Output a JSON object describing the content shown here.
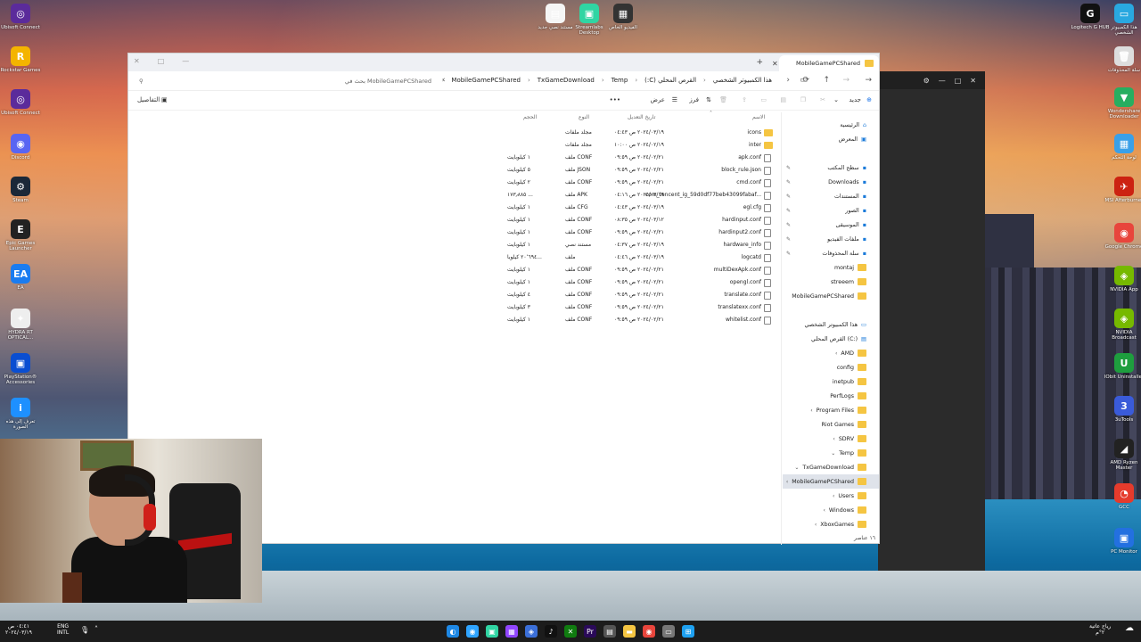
{
  "desktop_left": [
    {
      "label": "Ubisoft Connect",
      "color": "#5b2b9b",
      "glyph": "◎"
    },
    {
      "label": "Rockstar Games",
      "color": "#f4b400",
      "glyph": "R"
    },
    {
      "label": "Ubisoft Connect",
      "color": "#5b2b9b",
      "glyph": "◎"
    },
    {
      "label": "Discord",
      "color": "#5865f2",
      "glyph": "◉"
    },
    {
      "label": "Steam",
      "color": "#1b2838",
      "glyph": "⚙"
    },
    {
      "label": "Epic Games Launcher",
      "color": "#222",
      "glyph": "E"
    },
    {
      "label": "EA",
      "color": "#1a7cf0",
      "glyph": "EA"
    },
    {
      "label": "HYDRA RT OPTICAL...",
      "color": "#eee",
      "glyph": "✦"
    },
    {
      "label": "PlayStation® Accessories",
      "color": "#0a4ed1",
      "glyph": "▣"
    },
    {
      "label": "تعرف إلى هذه الصورة",
      "color": "#1e90ff",
      "glyph": "i"
    }
  ],
  "desktop_top": [
    {
      "label": "مستند نصي جديد",
      "color": "#f5f5f5",
      "glyph": "▤"
    },
    {
      "label": "Streamlabs Desktop",
      "color": "#30d5a3",
      "glyph": "▣"
    },
    {
      "label": "الفيديو الخاص",
      "color": "#333",
      "glyph": "▦"
    }
  ],
  "desktop_right": [
    {
      "label": "Logitech G HUB",
      "color": "#111",
      "glyph": "G"
    },
    {
      "label": "هذا الكمبيوتر الشخصي",
      "color": "#29a8e0",
      "glyph": "▭"
    },
    {
      "label": "سلة المحذوفات",
      "color": "#ddd",
      "glyph": "🗑"
    },
    {
      "label": "Wondershare Downloader",
      "color": "#27ae60",
      "glyph": "▼"
    },
    {
      "label": "لوحة التحكم",
      "color": "#3aa0e8",
      "glyph": "▦"
    },
    {
      "label": "MSI Afterburner",
      "color": "#c21",
      "glyph": "✈"
    },
    {
      "label": "Google Chrome",
      "color": "#e8453c",
      "glyph": "◉"
    },
    {
      "label": "NVIDIA App",
      "color": "#76b900",
      "glyph": "◈"
    },
    {
      "label": "NVIDIA Broadcast",
      "color": "#76b900",
      "glyph": "◈"
    },
    {
      "label": "IObit Uninstaller",
      "color": "#1e9e3e",
      "glyph": "U"
    },
    {
      "label": "3uTools",
      "color": "#3a5bd9",
      "glyph": "3"
    },
    {
      "label": "AMD Ryzen Master",
      "color": "#222",
      "glyph": "◢"
    },
    {
      "label": "GCC",
      "color": "#e53b2c",
      "glyph": "◔"
    },
    {
      "label": "PC Monitor",
      "color": "#2370e0",
      "glyph": "▣"
    }
  ],
  "explorer": {
    "tab_title": "MobileGamePCShared",
    "new_tab": "+",
    "breadcrumbs": [
      "هذا الكمبيوتر الشخصي",
      "القرص المحلي (C:)",
      "Temp",
      "TxGameDownload",
      "MobileGamePCShared"
    ],
    "search_placeholder": "بحث في MobileGamePCShared",
    "toolbar": {
      "new": "جديد",
      "sort": "فرز",
      "view": "عرض",
      "more": "•••",
      "details": "التفاصيل"
    },
    "columns": {
      "name": "الاسم",
      "date": "تاريخ التعديل",
      "type": "النوع",
      "size": "الحجم"
    },
    "files": [
      {
        "name": "icons",
        "date": "٢٠٢٤/٠٣/١٩ ص ٠٤:٤٣",
        "type": "مجلد ملفات",
        "size": "",
        "folder": true
      },
      {
        "name": "inter",
        "date": "٢٠٢٤/٠٢/١٩ ص ١٠:٠٠",
        "type": "مجلد ملفات",
        "size": "",
        "folder": true
      },
      {
        "name": "apk.conf",
        "date": "٢٠٢٤/٠٢/٢١ ص ٠٩:٥٩",
        "type": "ملف CONF",
        "size": "١ كيلوبايت",
        "folder": false
      },
      {
        "name": "block_rule.json",
        "date": "٢٠٢٤/٠٢/٢١ ص ٠٩:٥٩",
        "type": "ملف JSON",
        "size": "٥ كيلوبايت",
        "folder": false
      },
      {
        "name": "cmd.conf",
        "date": "٢٠٢٤/٠٢/٢١ ص ٠٩:٥٩",
        "type": "ملف CONF",
        "size": "٢ كيلوبايت",
        "folder": false
      },
      {
        "name": "com_tencent_ig_59d0df77beb43099fabaf...",
        "date": "٢٠٢٤/٠٣/١٩ ص ٠٤:١٦",
        "type": "ملف APK",
        "size": "١٧٣٫٨٨٥ ...",
        "folder": false
      },
      {
        "name": "egl.cfg",
        "date": "٢٠٢٤/٠٣/١٩ ص ٠٤:٤٣",
        "type": "ملف CFG",
        "size": "١ كيلوبايت",
        "folder": false
      },
      {
        "name": "hardinput.conf",
        "date": "٢٠٢٤/٠٣/١٢ ص ٠٨:٣٥",
        "type": "ملف CONF",
        "size": "١ كيلوبايت",
        "folder": false
      },
      {
        "name": "hardinput2.conf",
        "date": "٢٠٢٤/٠٢/٢١ ص ٠٩:٥٩",
        "type": "ملف CONF",
        "size": "١ كيلوبايت",
        "folder": false
      },
      {
        "name": "hardware_info",
        "date": "٢٠٢٤/٠٣/١٩ ص ٠٤:٣٧",
        "type": "مستند نصي",
        "size": "١ كيلوبايت",
        "folder": false
      },
      {
        "name": "logcatd",
        "date": "٢٠٢٤/٠٣/١٩ ص ٠٤:٤٦",
        "type": "ملف",
        "size": "٢٠٬٦٩٤ كيلوبا...",
        "folder": false
      },
      {
        "name": "multiDexApk.conf",
        "date": "٢٠٢٤/٠٢/٢١ ص ٠٩:٥٩",
        "type": "ملف CONF",
        "size": "١ كيلوبايت",
        "folder": false
      },
      {
        "name": "opengl.conf",
        "date": "٢٠٢٤/٠٢/٢١ ص ٠٩:٥٩",
        "type": "ملف CONF",
        "size": "١ كيلوبايت",
        "folder": false
      },
      {
        "name": "translate.conf",
        "date": "٢٠٢٤/٠٢/٢١ ص ٠٩:٥٩",
        "type": "ملف CONF",
        "size": "٤ كيلوبايت",
        "folder": false
      },
      {
        "name": "translatexx.conf",
        "date": "٢٠٢٤/٠٢/٢١ ص ٠٩:٥٩",
        "type": "ملف CONF",
        "size": "٣ كيلوبايت",
        "folder": false
      },
      {
        "name": "whitelist.conf",
        "date": "٢٠٢٤/٠٢/٢١ ص ٠٩:٥٩",
        "type": "ملف CONF",
        "size": "١ كيلوبايت",
        "folder": false
      }
    ],
    "sidebar": [
      {
        "label": "الرئيسية",
        "kind": "home"
      },
      {
        "label": "المعرض",
        "kind": "gallery"
      },
      {
        "label": "سطح المكتب",
        "kind": "pin"
      },
      {
        "label": "Downloads",
        "kind": "pin"
      },
      {
        "label": "المستندات",
        "kind": "pin"
      },
      {
        "label": "الصور",
        "kind": "pin"
      },
      {
        "label": "الموسيقى",
        "kind": "pin"
      },
      {
        "label": "ملفات الفيديو",
        "kind": "pin"
      },
      {
        "label": "سلة المحذوفات",
        "kind": "pin"
      },
      {
        "label": "montaj",
        "kind": "folder"
      },
      {
        "label": "streeem",
        "kind": "folder"
      },
      {
        "label": "MobileGamePCShared",
        "kind": "folder"
      },
      {
        "label": "هذا الكمبيوتر الشخصي",
        "kind": "pc"
      },
      {
        "label": "القرص المحلي (C:)",
        "kind": "drive"
      },
      {
        "label": "AMD",
        "kind": "folder"
      },
      {
        "label": "config",
        "kind": "folder"
      },
      {
        "label": "inetpub",
        "kind": "folder"
      },
      {
        "label": "PerfLogs",
        "kind": "folder"
      },
      {
        "label": "Program Files",
        "kind": "folder"
      },
      {
        "label": "Riot Games",
        "kind": "folder"
      },
      {
        "label": "SDRV",
        "kind": "folder"
      },
      {
        "label": "Temp",
        "kind": "folder"
      },
      {
        "label": "TxGameDownload",
        "kind": "folder"
      },
      {
        "label": "MobileGamePCShared",
        "kind": "folder"
      },
      {
        "label": "Users",
        "kind": "folder"
      },
      {
        "label": "Windows",
        "kind": "folder"
      },
      {
        "label": "XboxGames",
        "kind": "folder"
      }
    ],
    "status": "١٦ عناصر"
  },
  "taskbar": {
    "time": "٠٤:٤١ ص",
    "date": "٢٠٢٤/٠٣/١٩",
    "lang": "ENG",
    "lang2": "INTL",
    "weather": "رياح عاتية",
    "weather2": "٢°م",
    "apps": [
      {
        "name": "edge-app",
        "color": "#1e88e5",
        "glyph": "◐"
      },
      {
        "name": "browser-app",
        "color": "#2fa4ff",
        "glyph": "◉"
      },
      {
        "name": "streamlabs-app",
        "color": "#30d5a3",
        "glyph": "▣"
      },
      {
        "name": "twitch-app",
        "color": "#9146ff",
        "glyph": "▦"
      },
      {
        "name": "chat-app",
        "color": "#3b6fd8",
        "glyph": "◈"
      },
      {
        "name": "tiktok-app",
        "color": "#111",
        "glyph": "♪"
      },
      {
        "name": "xbox-app",
        "color": "#107c10",
        "glyph": "✕"
      },
      {
        "name": "premiere-app",
        "color": "#2a0a59",
        "glyph": "Pr"
      },
      {
        "name": "store-app",
        "color": "#555",
        "glyph": "▤"
      },
      {
        "name": "explorer-app",
        "color": "#f5c542",
        "glyph": "▬"
      },
      {
        "name": "chrome-app",
        "color": "#e8453c",
        "glyph": "◉"
      },
      {
        "name": "window-app",
        "color": "#777",
        "glyph": "▭"
      },
      {
        "name": "start-app",
        "color": "#1ea1f1",
        "glyph": "⊞"
      }
    ]
  }
}
